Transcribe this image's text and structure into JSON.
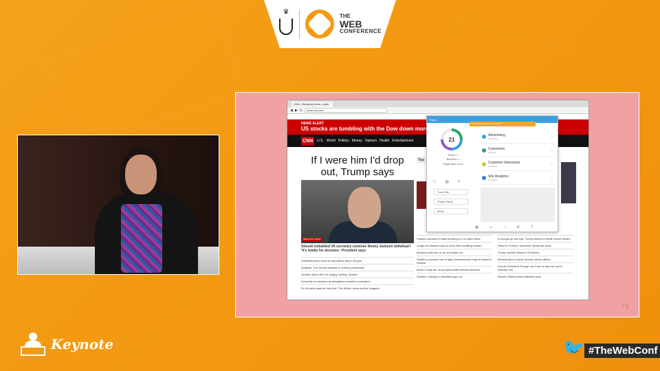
{
  "banner": {
    "conference_the": "THE",
    "conference_web": "WEB",
    "conference_word": "CONFERENCE"
  },
  "slide": {
    "page_number": "79"
  },
  "browser": {
    "tab_title": "CNN - Breaking News, Lates",
    "address": "www.cnn.com",
    "alert_kicker": "NEWS ALERT",
    "alert_text": "US stocks are tumbling with the Dow down more than",
    "nav_items": [
      "U.S.",
      "World",
      "Politics",
      "Money",
      "Opinion",
      "Health",
      "Entertainment"
    ],
    "headline": "If I were him I'd drop out, Trump says",
    "story": "Should embattled VA secretary nominee Ronny Jackson withdraw? 'It's totally his decision,' President says",
    "left_list": [
      "Whistleblowers come to lawmakers about VA pick",
      "Analysis: The VA pick debacle is entirely predictable",
      "Senator slams WH for 'sloppy' vetting: Opinion",
      "Scramble for answers as allegations threaten nomination",
      "Ex-VA adds says for look lost: The White House just be snagged"
    ],
    "mid_list": [
      "Suspect accused in fatal shooting of 4 is found dead",
      "Judge not allowed back in court after berating women",
      "Actress posts sex on air at a taser run",
      "Seattle's proposed tax to fight homelessness may hit Amazon hardest",
      "Bruce Cosby fair of accused Mattie Mcnew accused",
      "Senator: Vowing on heartbeat gun ad"
    ],
    "right_list": [
      "It brought up this eye: Trump election's White House picture",
      "Reserve Trump's 'someone' steals the show",
      "Trump mocked 'Behind' Of Marina",
      "Melania gives a pesk at black aborts attires",
      "Korean President George nnn Kuan to alert but yet in weirdley one",
      "Barack Obama shoes Melania pose"
    ],
    "col_top": "Top"
  },
  "extension": {
    "header": "Panel",
    "alert": "Some content has been blocked",
    "score": "21",
    "stats": [
      "Panel: 1",
      "Blocked: 1",
      "Page load: 4 ms"
    ],
    "buttons": [
      "Trust Site",
      "Pause Panel",
      "Menu"
    ],
    "categories": [
      {
        "label": "Advertising",
        "sub": "16 trackers",
        "color": "#3aa0e0"
      },
      {
        "label": "Comments",
        "sub": "1 tracker",
        "color": "#2aa36a"
      },
      {
        "label": "Customer Interaction",
        "sub": "2 trackers",
        "color": "#c8c83a"
      },
      {
        "label": "Site Analytics",
        "sub": "2 trackers",
        "color": "#3a7ae0"
      }
    ]
  },
  "bottom": {
    "keynote_label": "Keynote",
    "hashtag": "#TheWebConf"
  },
  "colors": {
    "background": "#f39a12",
    "slide_bg": "#f1a1a4",
    "cnn_red": "#cc0000",
    "twitter": "#2a8de0"
  }
}
